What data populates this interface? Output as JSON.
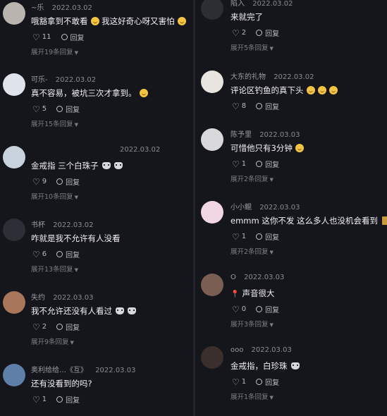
{
  "ui": {
    "expand_suffix": "条回复",
    "reply_label": "回复",
    "colors": {
      "background": "#15161c",
      "text": "#f1f1f3",
      "muted": "#8a8b93",
      "accent_emoji": "#f5c542"
    }
  },
  "left": [
    {
      "name": "~乐",
      "date": "2022.03.02",
      "text": "哦豁拿到不敢看",
      "text2": "我这好奇心呀又害怕",
      "likes": "11",
      "reply": "回复",
      "expand": "展开19条回复"
    },
    {
      "name": "可乐-",
      "date": "2022.03.02",
      "text": "真不容易，被坑三次才拿到。",
      "likes": "5",
      "reply": "回复",
      "expand": "展开15条回复"
    },
    {
      "name": "",
      "date": "2022.03.02",
      "text": "金戒指 三个白珠子",
      "likes": "9",
      "reply": "回复",
      "expand": "展开10条回复"
    },
    {
      "name": "书杯",
      "date": "2022.03.02",
      "text": "咋就是我不允许有人没看",
      "likes": "6",
      "reply": "回复",
      "expand": "展开13条回复"
    },
    {
      "name": "失约",
      "date": "2022.03.03",
      "text": "我不允许还没有人看过",
      "likes": "2",
      "reply": "回复",
      "expand": "展开9条回复"
    },
    {
      "name": "奥利给给…《互》",
      "date": "2022.03.03",
      "text": "还有没看到的吗?",
      "likes": "1",
      "reply": "回复",
      "expand": ""
    }
  ],
  "right": [
    {
      "name": "陷入",
      "date": "2022.03.02",
      "text": "来就完了",
      "likes": "2",
      "reply": "回复",
      "expand": "展开5条回复"
    },
    {
      "name": "大东的礼物",
      "date": "2022.03.02",
      "text": "评论区钓鱼的真下头",
      "likes": "8",
      "reply": "回复",
      "expand": ""
    },
    {
      "name": "陈予里",
      "date": "2022.03.03",
      "text": "可惜他只有3分钟",
      "likes": "1",
      "reply": "回复",
      "expand": "展开2条回复"
    },
    {
      "name": "小小鲲",
      "date": "2022.03.03",
      "text": "emmm 这你不发 这么多人也没机会看到",
      "likes": "1",
      "reply": "回复",
      "expand": "展开2条回复"
    },
    {
      "name": "O",
      "date": "2022.03.03",
      "text": "声音很大",
      "likes": "0",
      "reply": "回复",
      "expand": "展开3条回复"
    },
    {
      "name": "ooo",
      "date": "2022.03.03",
      "text": "金戒指，白珍珠",
      "likes": "1",
      "reply": "回复",
      "expand": "展开1条回复"
    }
  ]
}
